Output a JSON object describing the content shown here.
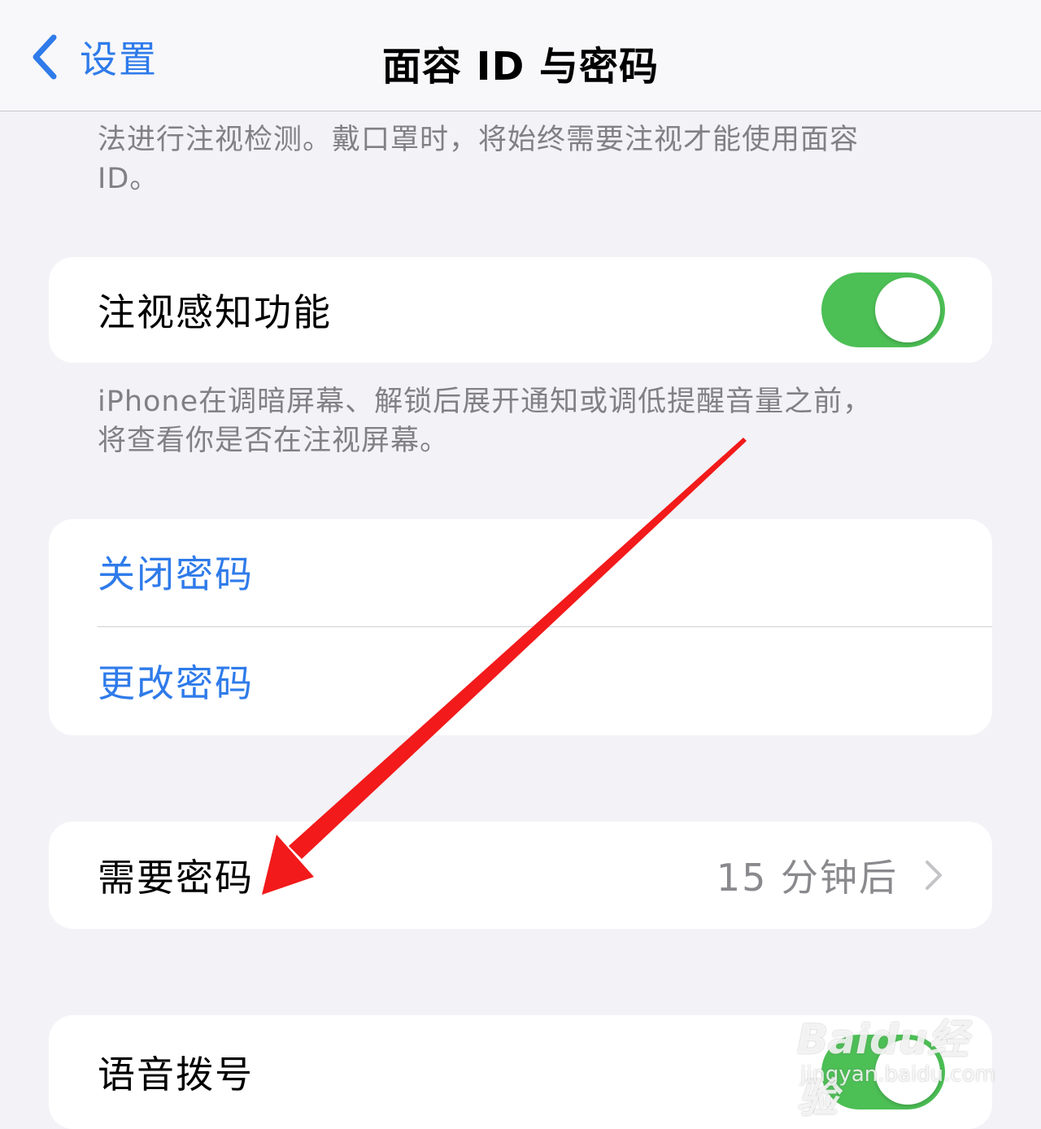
{
  "nav": {
    "back_label": "设置",
    "title": "面容 ID 与密码"
  },
  "top_footnote": {
    "line1": "法进行注视检测。戴口罩时，将始终需要注视才能使用面容",
    "line2": "ID。"
  },
  "attention_card": {
    "label": "注视感知功能",
    "toggle_on": true
  },
  "attention_footnote": {
    "line1": "iPhone在调暗屏幕、解锁后展开通知或调低提醒音量之前，",
    "line2": "将查看你是否在注视屏幕。"
  },
  "passcode_card": {
    "items": [
      {
        "label": "关闭密码"
      },
      {
        "label": "更改密码"
      }
    ]
  },
  "require_card": {
    "label": "需要密码",
    "value": "15 分钟后"
  },
  "voice_card": {
    "label": "语音拨号",
    "toggle_on": true
  },
  "watermark": {
    "brand": "Baidu经验",
    "url": "jingyan.baidu.com"
  },
  "colors": {
    "accent": "#2f7bea",
    "toggle_on": "#4cbf55",
    "annotation_arrow": "#f21a1a",
    "background": "#f2f2f7"
  }
}
